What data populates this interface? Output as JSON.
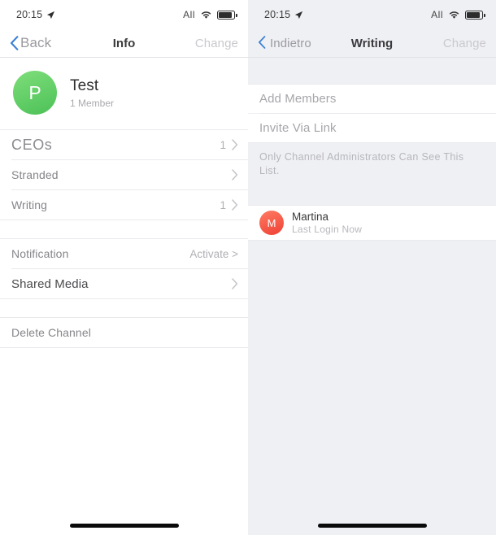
{
  "left": {
    "status": {
      "time": "20:15",
      "carrier": "All",
      "location_icon": "location-arrow-icon",
      "wifi_icon": "wifi-icon",
      "battery_icon": "battery-icon"
    },
    "nav": {
      "back_label": "Back",
      "title": "Info",
      "action_label": "Change"
    },
    "hero": {
      "avatar_letter": "P",
      "avatar_color": "#4cc157",
      "title": "Test",
      "subtitle": "1 Member"
    },
    "rows": [
      {
        "label": "CEOs",
        "count": "1",
        "chevron": true
      },
      {
        "label": "Stranded",
        "count": "",
        "chevron": true
      },
      {
        "label": "Writing",
        "count": "1",
        "chevron": true
      }
    ],
    "settings": [
      {
        "label": "Notification",
        "value": "Activate >",
        "chevron": false
      },
      {
        "label": "Shared Media",
        "value": "",
        "chevron": true
      }
    ],
    "destructive": {
      "label": "Delete Channel"
    }
  },
  "right": {
    "status": {
      "time": "20:15",
      "carrier": "All",
      "location_icon": "location-arrow-icon",
      "wifi_icon": "wifi-icon",
      "battery_icon": "battery-icon"
    },
    "nav": {
      "back_label": "Indietro",
      "title": "Writing",
      "action_label": "Change"
    },
    "actions": [
      {
        "label": "Add Members"
      },
      {
        "label": "Invite Via Link"
      }
    ],
    "footnote": "Only Channel Administrators Can See This List.",
    "members": [
      {
        "avatar_letter": "M",
        "avatar_color": "#ef4136",
        "name": "Martina",
        "subtitle": "Last Login Now"
      }
    ]
  }
}
